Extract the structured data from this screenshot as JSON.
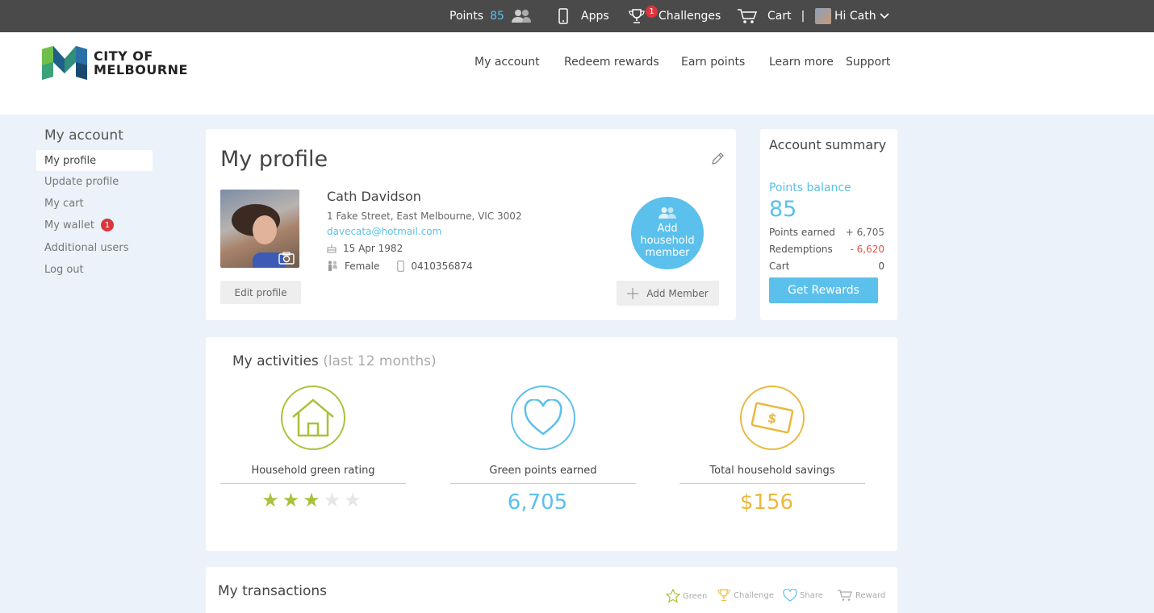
{
  "topbar": {
    "points_label": "Points",
    "points_value": "85",
    "apps_label": "Apps",
    "challenges_label": "Challenges",
    "challenges_badge": "1",
    "cart_label": "Cart",
    "separator": "|",
    "greeting": "Hi Cath"
  },
  "logo": {
    "line1": "CITY OF",
    "line2": "MELBOURNE"
  },
  "nav": [
    "My account",
    "Redeem rewards",
    "Earn points",
    "Learn more",
    "Support"
  ],
  "sidebar": {
    "title": "My account",
    "items": [
      {
        "label": "My profile",
        "active": true
      },
      {
        "label": "Update profile"
      },
      {
        "label": "My cart"
      },
      {
        "label": "My wallet",
        "badge": "1"
      },
      {
        "label": "Additional users"
      },
      {
        "label": "Log out"
      }
    ]
  },
  "profile": {
    "title": "My profile",
    "name": "Cath Davidson",
    "address": "1 Fake Street, East Melbourne, VIC 3002",
    "email": "davecata@hotmail.com",
    "dob": "15 Apr 1982",
    "gender": "Female",
    "phone": "0410356874",
    "edit_button": "Edit profile",
    "household_line1": "Add",
    "household_line2": "household",
    "household_line3": "member",
    "add_member_button": "Add Member"
  },
  "summary": {
    "title": "Account summary",
    "balance_label": "Points balance",
    "balance_value": "85",
    "rows": [
      {
        "label": "Points earned",
        "value": "+ 6,705"
      },
      {
        "label": "Redemptions",
        "value": "- 6,620"
      },
      {
        "label": "Cart",
        "value": "0"
      }
    ],
    "button": "Get Rewards"
  },
  "activities": {
    "title": "My activities",
    "subtitle": "(last 12 months)",
    "household_label": "Household green rating",
    "rating": {
      "value": 3,
      "max": 5
    },
    "points_label": "Green points earned",
    "points_value": "6,705",
    "savings_label": "Total household savings",
    "savings_value": "$156"
  },
  "transactions": {
    "title": "My transactions",
    "legend": [
      "Green",
      "Challenge",
      "Share",
      "Reward"
    ]
  },
  "colors": {
    "accent_blue": "#5bc0eb",
    "green": "#a8c23a",
    "gold": "#e8b93c",
    "badge_red": "#d9363e"
  }
}
